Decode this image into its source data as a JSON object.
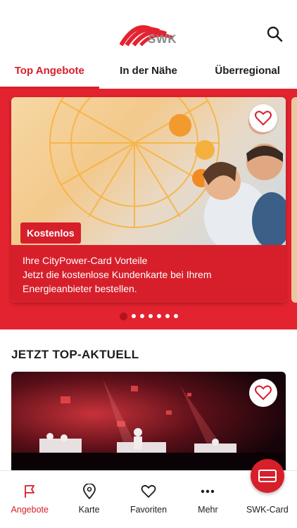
{
  "brand": {
    "logo_text": "SWK",
    "accent": "#d71f2b"
  },
  "tabs": [
    {
      "label": "Top Angebote",
      "active": true
    },
    {
      "label": "In der Nähe",
      "active": false
    },
    {
      "label": "Überregional",
      "active": false
    }
  ],
  "hero_card": {
    "badge": "Kostenlos",
    "line1": "Ihre CityPower-Card Vorteile",
    "line2": "Jetzt die kostenlose Kundenkarte bei Ihrem Energieanbieter bestellen."
  },
  "carousel": {
    "count": 7,
    "active_index": 0
  },
  "section": {
    "title": "JETZT TOP-AKTUELL"
  },
  "bottom_nav": [
    {
      "label": "Angebote",
      "icon": "flag-icon",
      "active": true
    },
    {
      "label": "Karte",
      "icon": "map-pin-icon",
      "active": false
    },
    {
      "label": "Favoriten",
      "icon": "heart-icon",
      "active": false
    },
    {
      "label": "Mehr",
      "icon": "more-dots-icon",
      "active": false
    },
    {
      "label": "SWK-Card",
      "icon": "card-icon",
      "active": false
    }
  ]
}
